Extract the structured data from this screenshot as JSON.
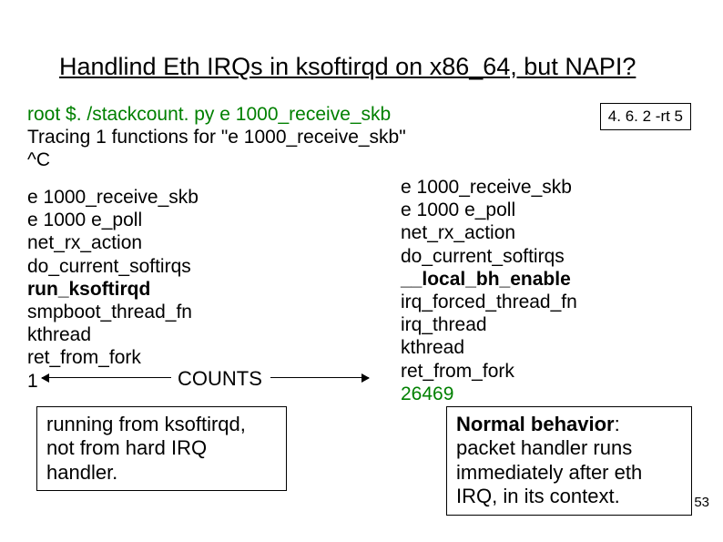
{
  "title": "Handlind Eth IRQs in ksoftirqd on x86_64, but NAPI?",
  "command": "root $. /stackcount. py e 1000_receive_skb",
  "intro1": "Tracing 1 functions for \"e 1000_receive_skb\"",
  "intro2": "^C",
  "version": "4. 6. 2 -rt 5",
  "left_trace": {
    "l1": "e 1000_receive_skb",
    "l2": "e 1000 e_poll",
    "l3": "net_rx_action",
    "l4": "do_current_softirqs",
    "l5": "run_ksoftirqd",
    "l6": "smpboot_thread_fn",
    "l7": "kthread",
    "l8": "ret_from_fork",
    "count": "1"
  },
  "counts_label": "COUNTS",
  "left_note": "running from ksoftirqd, not from hard IRQ handler.",
  "right_trace": {
    "l1": "e 1000_receive_skb",
    "l2": "e 1000 e_poll",
    "l3": "net_rx_action",
    "l4": "do_current_softirqs",
    "l5": "__local_bh_enable",
    "l6": "irq_forced_thread_fn",
    "l7": "irq_thread",
    "l8": "kthread",
    "l9": "ret_from_fork",
    "count": "26469"
  },
  "right_note_bold": "Normal behavior",
  "right_note_rest": ": packet handler runs immediately after eth IRQ, in its context.",
  "page": "53"
}
